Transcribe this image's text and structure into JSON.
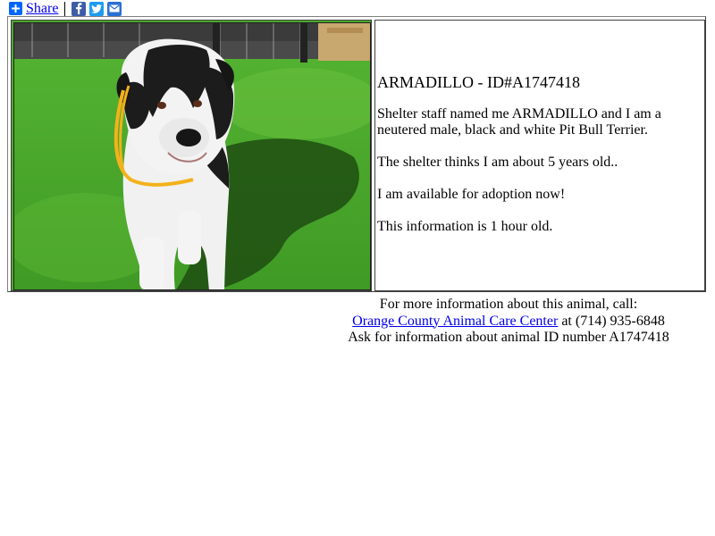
{
  "share": {
    "label": "Share",
    "icons": [
      "plus-icon",
      "facebook-icon",
      "twitter-icon",
      "email-icon"
    ]
  },
  "animal": {
    "photo_alt": "Photo of ARMADILLO",
    "name_line": "ARMADILLO - ID#A1747418",
    "description": "Shelter staff named me ARMADILLO and I am a neutered male, black and white Pit Bull Terrier.",
    "age_line": "The shelter thinks I am about 5 years old..",
    "availability": "I am available for adoption now!",
    "freshness": "This information is 1 hour old."
  },
  "footer": {
    "line1": "For more information about this animal, call:",
    "shelter_link": "Orange County Animal Care Center",
    "phone_text": " at (714) 935-6848",
    "line3": "Ask for information about animal ID number A1747418"
  },
  "colors": {
    "link": "#0000ee",
    "share_blue": "#0166ff",
    "facebook": "#3d5ca8",
    "twitter": "#1d9bf0",
    "email": "#2a6fd6"
  }
}
